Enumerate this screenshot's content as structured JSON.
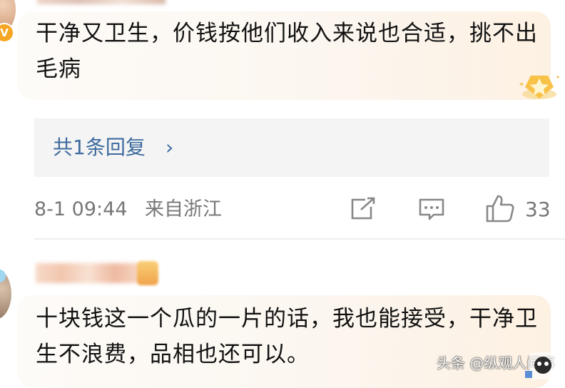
{
  "top_comment": {
    "verified_icon": "verified-v-icon",
    "text": "干净又卫生，价钱按他们收入来说也合适，挑不出毛病",
    "badge_icon": "star-badge-icon",
    "reply_summary": "共1条回复",
    "reply_chevron": "›",
    "time": "8-1 09:44",
    "location": "来自浙江",
    "like_count": "33"
  },
  "second_comment": {
    "text": "十块钱这一个瓜的一片的话，我也能接受，干净卫生不浪费，品相也还可以。"
  },
  "watermark": "头条 @纵观人间事",
  "colors": {
    "bubble": "#fcf6ef",
    "reply_link": "#3d6a9e",
    "meta_text": "#777777",
    "reply_box": "#f4f4f4"
  }
}
